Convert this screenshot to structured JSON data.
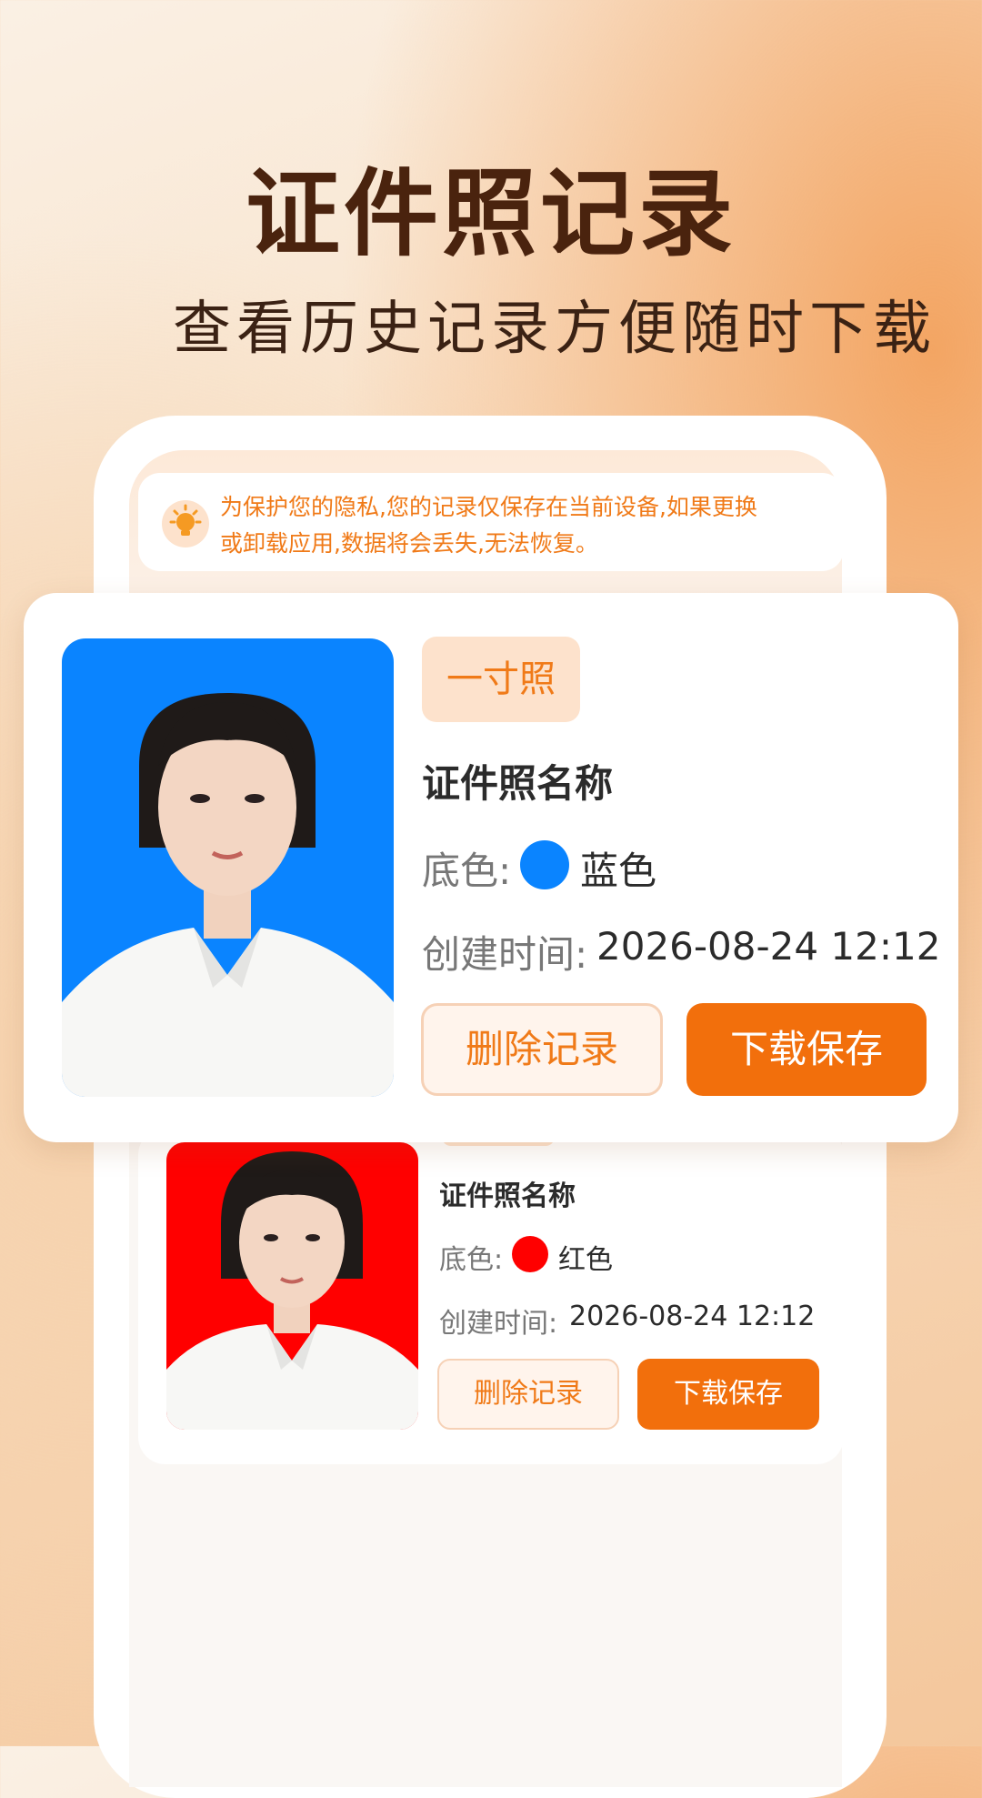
{
  "headline": "证件照记录",
  "subline": "查看历史记录方便随时下载",
  "notice": {
    "icon": "lightbulb-icon",
    "line1": "为保护您的隐私,您的记录仅保存在当前设备,如果更换",
    "line2": "或卸载应用,数据将会丢失,无法恢复。"
  },
  "records": [
    {
      "tag": "一寸照",
      "name": "证件照名称",
      "color_label": "底色:",
      "color_name": "蓝色",
      "color_hex": "#0a84ff",
      "time_label": "创建时间:",
      "time": "2026-08-24 12:12",
      "delete_label": "删除记录",
      "download_label": "下载保存"
    },
    {
      "name": "证件照名称",
      "color_label": "底色:",
      "color_name": "红色",
      "color_hex": "#ff0000",
      "time_label": "创建时间:",
      "time": "2026-08-24 12:12",
      "delete_label": "删除记录",
      "download_label": "下载保存"
    }
  ],
  "colors": {
    "accent": "#f26f0c",
    "accent_light": "#fde2cc",
    "title": "#4a230e"
  }
}
